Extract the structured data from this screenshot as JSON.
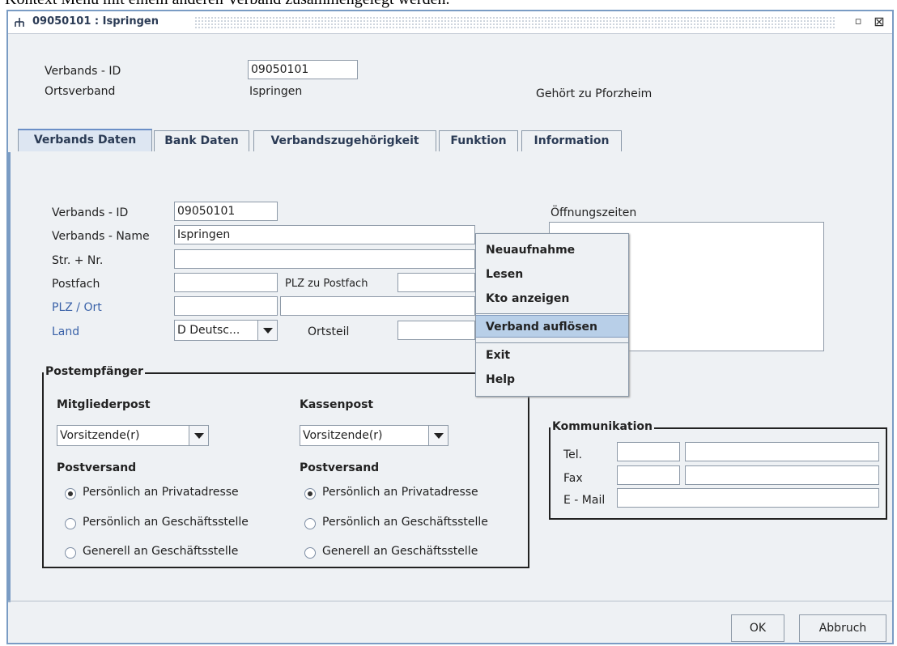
{
  "caption_text": "Kontext Menü mit einem anderen Verband zusammengelegt werden.",
  "window": {
    "title": "09050101 : Ispringen",
    "minimize_glyph": "▫",
    "close_glyph": "⊠"
  },
  "header": {
    "id_label": "Verbands - ID",
    "id_value": "09050101",
    "ov_label": "Ortsverband",
    "ov_value": "Ispringen",
    "belongs": "Gehört zu Pforzheim"
  },
  "tabs": [
    {
      "label": "Verbands Daten",
      "active": true
    },
    {
      "label": "Bank Daten"
    },
    {
      "label": "Verbandszugehörigkeit"
    },
    {
      "label": "Funktion"
    },
    {
      "label": "Information"
    }
  ],
  "form": {
    "id_label": "Verbands - ID",
    "id_value": "09050101",
    "name_label": "Verbands - Name",
    "name_value": "Ispringen",
    "street_label": "Str. + Nr.",
    "street_value": "",
    "pobox_label": "Postfach",
    "pobox_value": "",
    "plz_pobox_label": "PLZ zu Postfach",
    "plz_pobox_value": "",
    "plzort_label": "PLZ / Ort",
    "land_label": "Land",
    "land_value": "D Deutsc...",
    "ortsteil_label": "Ortsteil",
    "hours_label": "Öffnungszeiten"
  },
  "post": {
    "group_title": "Postempfänger",
    "members_title": "Mitgliederpost",
    "members_value": "Vorsitzende(r)",
    "cash_title": "Kassenpost",
    "cash_value": "Vorsitzende(r)",
    "shipping_title": "Postversand",
    "options": [
      "Persönlich an Privatadresse",
      "Persönlich an Geschäftsstelle",
      "Generell an Geschäftsstelle"
    ]
  },
  "comm": {
    "group_title": "Kommunikation",
    "tel": "Tel.",
    "fax": "Fax",
    "email": "E - Mail"
  },
  "context_menu": [
    "Neuaufnahme",
    "Lesen",
    "Kto anzeigen",
    "Verband auflösen",
    "Exit",
    "Help"
  ],
  "context_menu_highlight": "Verband auflösen",
  "buttons": {
    "ok": "OK",
    "cancel": "Abbruch"
  },
  "colors": {
    "accent": "#7a9cc4",
    "highlight": "#b8cfe8",
    "label_blue": "#3a62a8"
  }
}
